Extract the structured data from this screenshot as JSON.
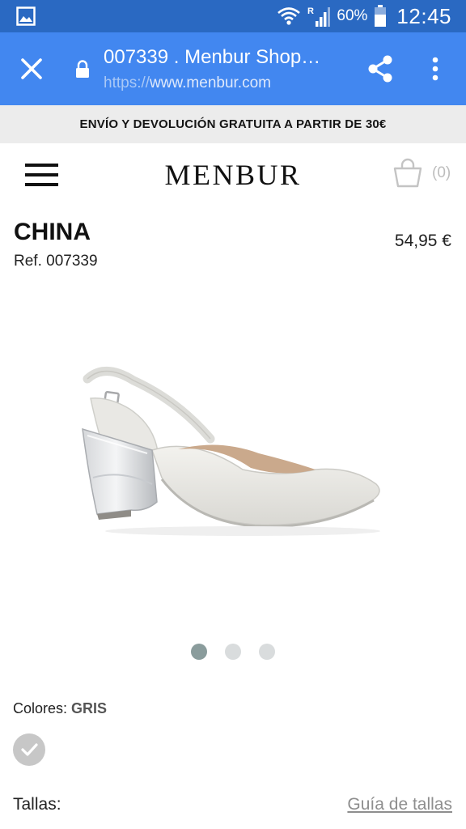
{
  "status_bar": {
    "battery_percent": "60%",
    "time": "12:45",
    "network_label": "R",
    "icons": [
      "gallery-icon",
      "wifi-icon",
      "signal-icon",
      "battery-icon"
    ]
  },
  "browser": {
    "title": "007339 . Menbur Shop…",
    "url_scheme": "https://",
    "url_host": "www.menbur.com",
    "icons": [
      "close-icon",
      "lock-icon",
      "share-icon",
      "more-vertical-icon"
    ]
  },
  "promo": {
    "text": "ENVÍO Y DEVOLUCIÓN GRATUITA A PARTIR DE 30€"
  },
  "site_header": {
    "logo": "MENBUR",
    "cart_count": "(0)",
    "icons": [
      "menu-icon",
      "shopping-bag-icon"
    ]
  },
  "product": {
    "name": "CHINA",
    "ref": "Ref. 007339",
    "price": "54,95 €"
  },
  "gallery": {
    "slide_count": 3,
    "active_index": 0
  },
  "colors": {
    "label": "Colores:",
    "selected": "GRIS",
    "swatch_color": "#c7c7c7"
  },
  "sizes": {
    "label": "Tallas:",
    "guide_link": "Guía de tallas"
  },
  "theme": {
    "status_bar_bg": "#2a69c2",
    "browser_bar_bg": "#4287f0",
    "promo_bg": "#ececec"
  }
}
